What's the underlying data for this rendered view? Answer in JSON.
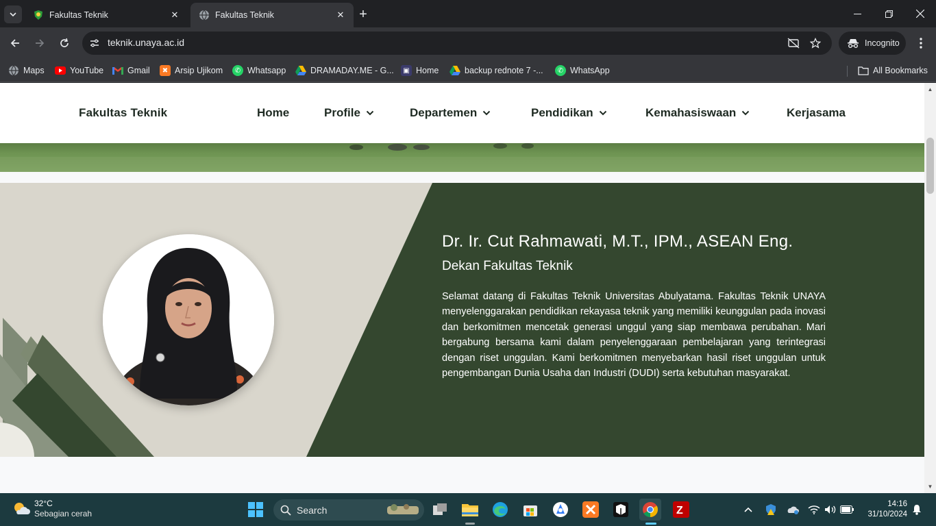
{
  "browser": {
    "tabs": [
      {
        "title": "Fakultas Teknik",
        "state": "inactive",
        "favicon": "unaya-shield-icon"
      },
      {
        "title": "Fakultas Teknik",
        "state": "active",
        "favicon": "globe-icon"
      }
    ],
    "url": "teknik.unaya.ac.id",
    "incognito_label": "Incognito",
    "bookmarks": [
      {
        "label": "Maps",
        "icon": "maps-icon"
      },
      {
        "label": "YouTube",
        "icon": "youtube-icon"
      },
      {
        "label": "Gmail",
        "icon": "gmail-icon"
      },
      {
        "label": "Arsip Ujikom",
        "icon": "xampp-icon"
      },
      {
        "label": "Whatsapp",
        "icon": "whatsapp-icon"
      },
      {
        "label": "DRAMADAY.ME - G...",
        "icon": "google-drive-icon"
      },
      {
        "label": "Home",
        "icon": "home-site-icon"
      },
      {
        "label": "backup rednote 7 -...",
        "icon": "google-drive-icon"
      },
      {
        "label": "WhatsApp",
        "icon": "whatsapp-icon"
      }
    ],
    "all_bookmarks_label": "All Bookmarks"
  },
  "site": {
    "brand": "Fakultas Teknik",
    "nav": [
      {
        "label": "Home",
        "has_dropdown": false
      },
      {
        "label": "Profile",
        "has_dropdown": true
      },
      {
        "label": "Departemen",
        "has_dropdown": true
      },
      {
        "label": "Pendidikan",
        "has_dropdown": true
      },
      {
        "label": "Kemahasiswaan",
        "has_dropdown": true
      },
      {
        "label": "Kerjasama",
        "has_dropdown": false
      }
    ],
    "dean": {
      "name": "Dr. Ir. Cut Rahmawati, M.T., IPM., ASEAN Eng.",
      "role": "Dekan Fakultas Teknik",
      "message": "Selamat datang di Fakultas Teknik Universitas Abulyatama. Fakultas Teknik UNAYA menyelenggarakan pendidikan rekayasa teknik yang memiliki keunggulan pada inovasi dan berkomitmen mencetak generasi unggul yang siap membawa perubahan. Mari bergabung bersama kami dalam penyelenggaraan pembelajaran yang terintegrasi dengan riset unggulan. Kami berkomitmen menyebarkan hasil riset unggulan untuk pengembangan Dunia Usaha dan Industri (DUDI) serta kebutuhan masyarakat."
    },
    "colors": {
      "dark_green": "#34472f",
      "beige": "#d9d6cc"
    }
  },
  "taskbar": {
    "weather_temp": "32°C",
    "weather_desc": "Sebagian cerah",
    "search_label": "Search",
    "time": "14:16",
    "date": "31/10/2024",
    "apps": [
      "windows-start-icon",
      "task-view-icon",
      "file-explorer-icon",
      "edge-icon",
      "microsoft-store-icon",
      "app-icon",
      "xampp-icon",
      "terminal-icon",
      "chrome-icon",
      "filezilla-icon"
    ]
  }
}
